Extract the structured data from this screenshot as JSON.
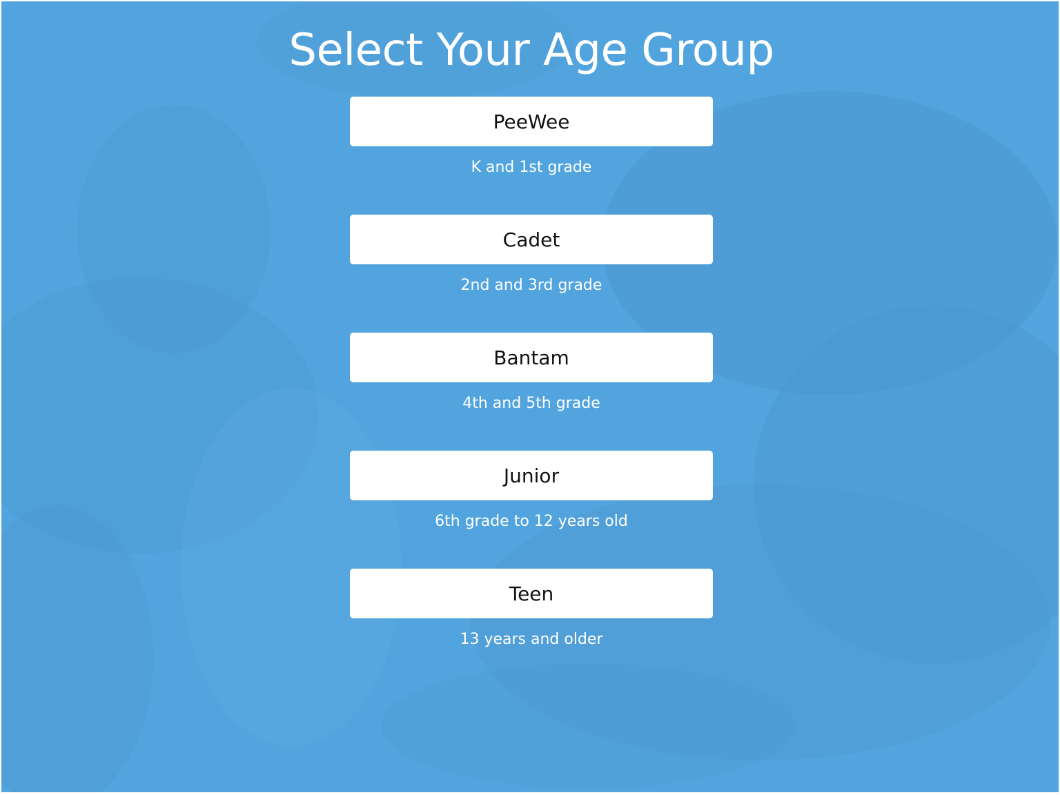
{
  "page": {
    "title": "Select Your Age Group",
    "background_color": "#52a4de",
    "background_image": "blurred photo of kids outdoors with a blue overlay"
  },
  "age_groups": [
    {
      "label": "PeeWee",
      "description": "K and 1st grade"
    },
    {
      "label": "Cadet",
      "description": "2nd and 3rd grade"
    },
    {
      "label": "Bantam",
      "description": "4th and 5th grade"
    },
    {
      "label": "Junior",
      "description": "6th grade to 12 years old"
    },
    {
      "label": "Teen",
      "description": "13 years and older"
    }
  ]
}
